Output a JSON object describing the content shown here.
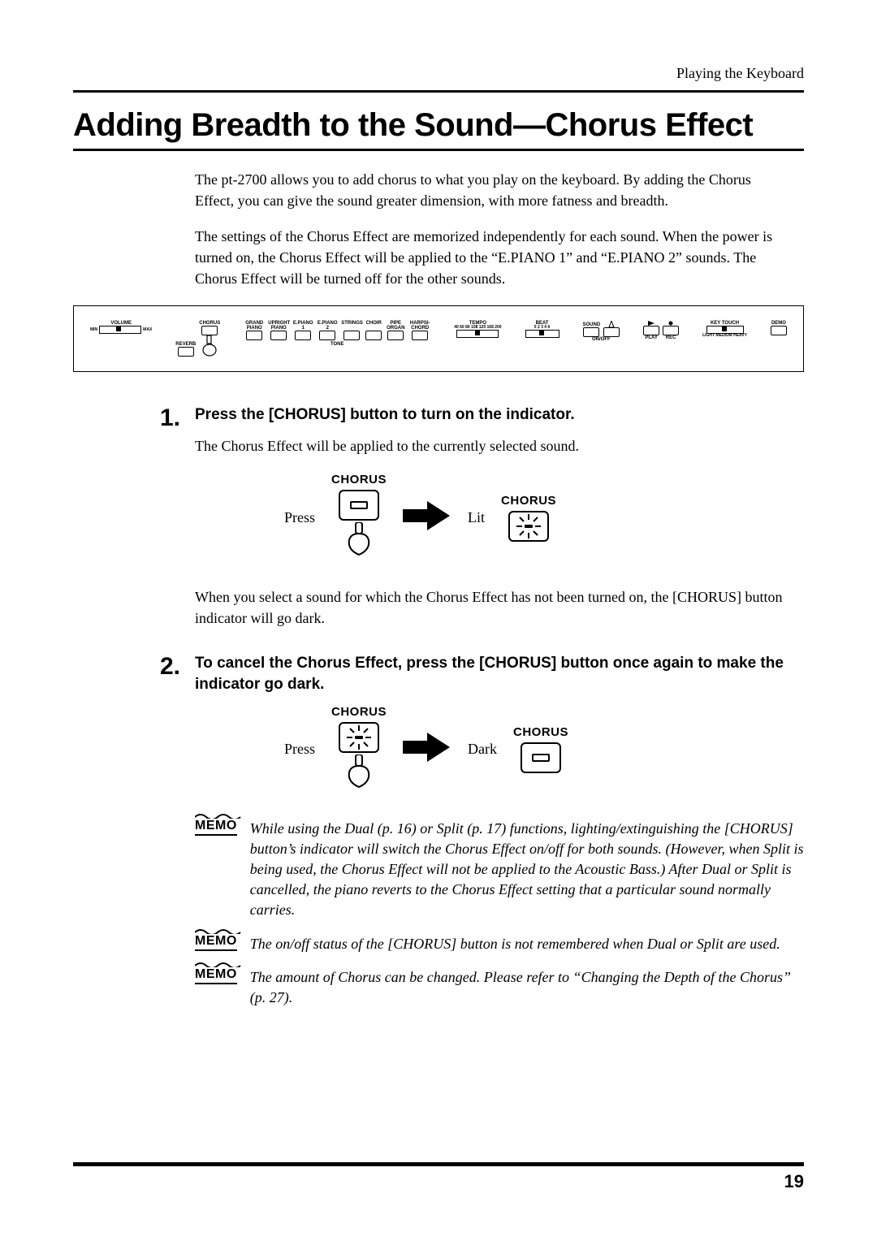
{
  "header": {
    "section": "Playing the Keyboard"
  },
  "title": "Adding Breadth to the Sound—Chorus Effect",
  "intro": [
    "The pt-2700 allows you to add chorus to what you play on the keyboard.\nBy adding the Chorus Effect, you can give the sound greater dimension, with more fatness and breadth.",
    "The settings of the Chorus Effect are memorized independently for each sound. When the power is turned on, the Chorus Effect will be applied to the “E.PIANO 1” and “E.PIANO 2” sounds. The Chorus Effect will be turned off for the other sounds."
  ],
  "panel": {
    "volume": "VOLUME",
    "volume_min": "MIN",
    "volume_max": "MAX",
    "reverb": "REVERB",
    "chorus": "CHORUS",
    "tones_label": "TONE",
    "tones": [
      "GRAND PIANO",
      "UPRIGHT PIANO",
      "E.PIANO 1",
      "E.PIANO 2",
      "STRINGS",
      "CHOIR",
      "PIPE ORGAN",
      "HARPSI-CHORD"
    ],
    "tempo": "TEMPO",
    "tempo_ticks": "40 60 80 108 120 168 200",
    "beat": "BEAT",
    "beat_ticks": "0   2   3   4   6",
    "sound": "SOUND",
    "metronome_icon": "metronome-icon",
    "onoff": "ON/OFF",
    "play": "PLAY",
    "rec": "REC",
    "keytouch": "KEY TOUCH",
    "keytouch_ticks": "LIGHT   MEDIUM   HEAVY",
    "demo": "DEMO"
  },
  "steps": [
    {
      "num": "1.",
      "head": "Press the [CHORUS] button to turn on the indicator.",
      "text_before_fig": "The Chorus Effect will be applied to the currently selected sound.",
      "fig": {
        "left_label": "Press",
        "right_label": "Lit",
        "title": "CHORUS"
      },
      "text_after_fig": "When you select a sound for which the Chorus Effect has not been turned on, the [CHORUS] button indicator will go dark."
    },
    {
      "num": "2.",
      "head": "To cancel the Chorus Effect, press the [CHORUS] button once again to make the indicator go dark.",
      "fig": {
        "left_label": "Press",
        "right_label": "Dark",
        "title": "CHORUS"
      }
    }
  ],
  "memos": [
    "While using the Dual (p. 16) or Split (p. 17) functions, lighting/extinguishing the [CHORUS] button’s indicator will switch the Chorus Effect on/off for both sounds. (However, when Split is being used, the Chorus Effect will not be applied to the Acoustic Bass.)\nAfter Dual or Split is cancelled, the piano reverts to the Chorus Effect setting that a particular sound normally carries.",
    "The on/off status of the [CHORUS] button is not remembered when Dual or Split are used.",
    "The amount of Chorus can be changed. Please refer to “Changing the Depth of the Chorus” (p. 27)."
  ],
  "memo_label": "MEMO",
  "page_number": "19"
}
